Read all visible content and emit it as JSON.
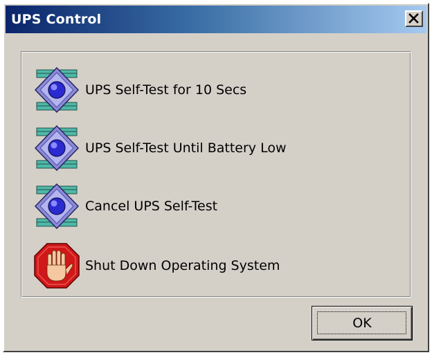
{
  "window": {
    "title": "UPS Control",
    "close_icon": "close-icon"
  },
  "actions": [
    {
      "label": "UPS Self-Test for 10 Secs",
      "icon": "self-test-icon"
    },
    {
      "label": "UPS Self-Test Until Battery Low",
      "icon": "self-test-icon"
    },
    {
      "label": "Cancel UPS Self-Test",
      "icon": "self-test-icon"
    },
    {
      "label": "Shut Down Operating System",
      "icon": "stop-hand-icon"
    }
  ],
  "buttons": {
    "ok_label": "OK"
  },
  "colors": {
    "titlebar_start": "#0a246a",
    "titlebar_end": "#a6caf0",
    "dialog_bg": "#d4d0c8",
    "stop_red": "#d01818"
  }
}
